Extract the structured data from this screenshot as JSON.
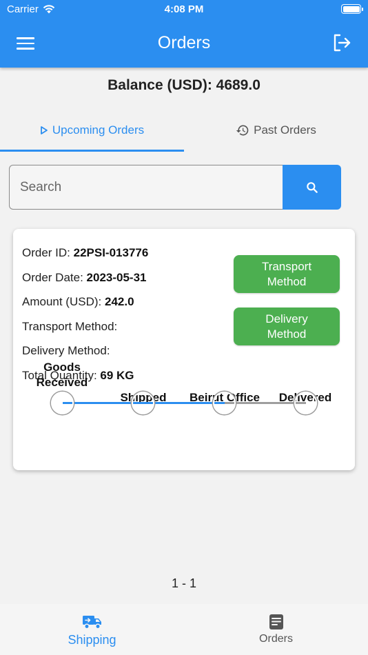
{
  "status_bar": {
    "carrier": "Carrier",
    "time": "4:08 PM"
  },
  "app_bar": {
    "title": "Orders",
    "menu_icon": "hamburger-menu-icon",
    "logout_icon": "logout-icon"
  },
  "balance": {
    "text": "Balance (USD): 4689.0"
  },
  "tabs": [
    {
      "label": "Upcoming Orders",
      "icon": "play-outline-icon",
      "active": true
    },
    {
      "label": "Past Orders",
      "icon": "history-icon",
      "active": false
    }
  ],
  "search": {
    "placeholder": "Search",
    "value": ""
  },
  "order": {
    "id_label": "Order ID: ",
    "id_value": "22PSI-013776",
    "date_label": "Order Date: ",
    "date_value": "2023-05-31",
    "amount_label": "Amount (USD): ",
    "amount_value": "242.0",
    "transport_label": "Transport Method:",
    "delivery_label": "Delivery Method:",
    "quantity_label": "Total Quantity: ",
    "quantity_value": "69 KG",
    "transport_button": "Transport Method",
    "delivery_button": "Delivery Method",
    "steps": [
      {
        "label": "Goods Received",
        "done": true
      },
      {
        "label": "Shipped",
        "done": true
      },
      {
        "label": "Beirut Office",
        "done": true
      },
      {
        "label": "Delivered",
        "done": false
      }
    ]
  },
  "pagination": {
    "text": "1 - 1"
  },
  "bottom_nav": [
    {
      "label": "Shipping",
      "icon": "truck-icon",
      "active": true
    },
    {
      "label": "Orders",
      "icon": "document-list-icon",
      "active": false
    }
  ],
  "colors": {
    "primary": "#2b8ef0",
    "green": "#4caf50",
    "pending": "#9e9e9e"
  }
}
